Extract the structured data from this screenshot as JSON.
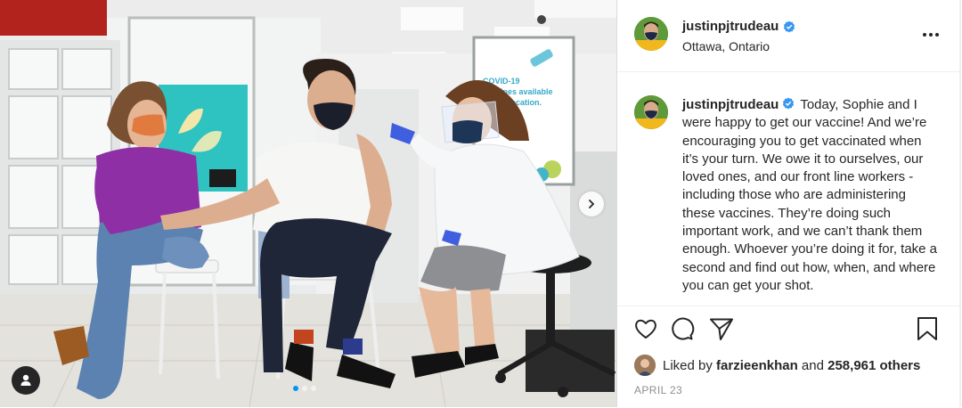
{
  "post": {
    "author": {
      "username": "justinpjtrudeau",
      "verified": true,
      "location": "Ottawa, Ontario"
    },
    "caption": "Today, Sophie and I were happy to get our vaccine! And we’re encouraging you to get vaccinated when it’s your turn. We owe it to ourselves, our loved ones, and our front line workers - including those who are administering these vaccines. They’re doing such important work, and we can’t thank them enough. Whoever you’re doing it for, take a second and find out how, when, and where you can get your shot.",
    "likes": {
      "liked_by": "farzieenkhan",
      "others": "258,961 others",
      "liked_by_prefix": "Liked by",
      "and": "and"
    },
    "date": "APRIL 23",
    "carousel": {
      "total": 3,
      "active_index": 0
    }
  },
  "photo": {
    "sign_text_1": "COVID-19",
    "sign_text_2": "vaccines available",
    "sign_text_3": "at this location.",
    "description_alt": "photo"
  },
  "icons": {
    "like": "heart-icon",
    "comment": "comment-icon",
    "share": "share-icon",
    "save": "bookmark-icon",
    "more": "more-icon",
    "verified": "verified-badge-icon",
    "next": "chevron-right-icon",
    "tags": "user-tag-icon"
  },
  "colors": {
    "verified": "#3897f0",
    "accent": "#0095f6",
    "muted": "#8e8e8e"
  }
}
